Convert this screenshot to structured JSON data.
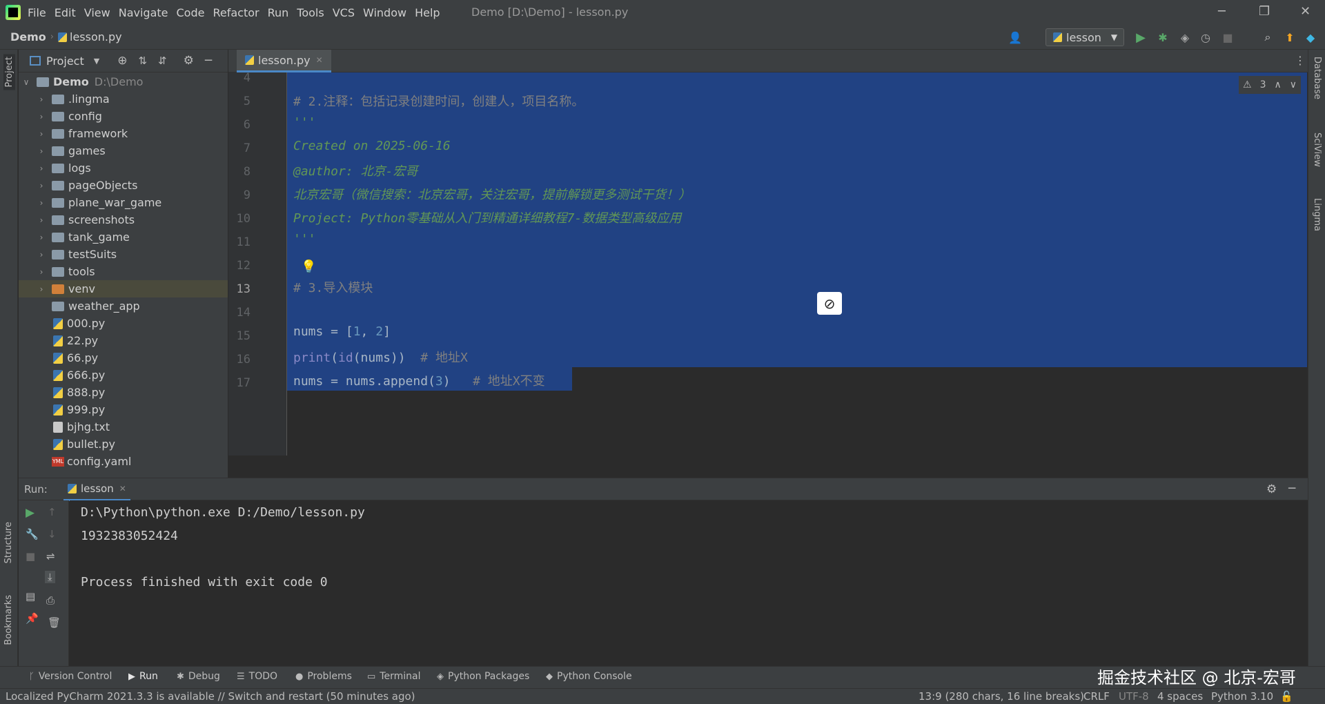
{
  "menu": {
    "items": [
      "File",
      "Edit",
      "View",
      "Navigate",
      "Code",
      "Refactor",
      "Run",
      "Tools",
      "VCS",
      "Window",
      "Help"
    ],
    "window_title": "Demo [D:\\Demo] - lesson.py"
  },
  "nav": {
    "project": "Demo",
    "file": "lesson.py",
    "run_config": "lesson"
  },
  "project_panel": {
    "title": "Project",
    "root_name": "Demo",
    "root_path": "D:\\Demo",
    "items": [
      ".lingma",
      "config",
      "framework",
      "games",
      "logs",
      "pageObjects",
      "plane_war_game",
      "screenshots",
      "tank_game",
      "testSuits",
      "tools",
      "venv",
      "weather_app",
      "000.py",
      "22.py",
      "66.py",
      "666.py",
      "888.py",
      "999.py",
      "bjhg.txt",
      "bullet.py",
      "config.yaml"
    ]
  },
  "editor": {
    "tab": "lesson.py",
    "warnings": "3",
    "line_numbers": [
      "4",
      "5",
      "6",
      "7",
      "8",
      "9",
      "10",
      "11",
      "12",
      "13",
      "14",
      "15",
      "16",
      "17"
    ],
    "lines": {
      "l5": "# 2.注释：包括记录创建时间，创建人，项目名称。",
      "l6": "'''",
      "l7": "Created on 2025-06-16",
      "l8": "@author: 北京-宏哥",
      "l9": "北京宏哥（微信搜索：北京宏哥，关注宏哥，提前解锁更多测试干货！）",
      "l10": "Project: Python零基础从入门到精通详细教程7-数据类型高级应用",
      "l11": "'''",
      "l13": "# 3.导入模块",
      "l15_a": "nums = [",
      "l15_b": "1",
      "l15_c": ", ",
      "l15_d": "2",
      "l15_e": "]",
      "l16_a": "print",
      "l16_b": "(",
      "l16_c": "id",
      "l16_d": "(nums))  ",
      "l16_e": "# 地址X",
      "l17_a": "nums = nums.append(",
      "l17_b": "3",
      "l17_c": ")   ",
      "l17_d": "# 地址X不变"
    }
  },
  "run_panel": {
    "label": "Run:",
    "tab": "lesson",
    "output": [
      "D:\\Python\\python.exe D:/Demo/lesson.py",
      "1932383052424",
      "",
      "Process finished with exit code 0"
    ]
  },
  "left_stripe": {
    "project": "Project",
    "structure": "Structure",
    "bookmarks": "Bookmarks"
  },
  "right_stripe": {
    "database": "Database",
    "sciview": "SciView",
    "lingma": "Lingma"
  },
  "tool_windows": [
    "Version Control",
    "Run",
    "Debug",
    "TODO",
    "Problems",
    "Terminal",
    "Python Packages",
    "Python Console"
  ],
  "status": {
    "message": "Localized PyCharm 2021.3.3 is available // Switch and restart (50 minutes ago)",
    "position": "13:9 (280 chars, 16 line breaks)",
    "line_sep": "CRLF",
    "encoding": "UTF-8",
    "indent": "4 spaces",
    "interpreter": "Python 3.10"
  },
  "watermark": "掘金技术社区 @ 北京-宏哥",
  "colors": {
    "selection": "#214283",
    "background": "#2b2b2b",
    "panel": "#3c3f41",
    "docstring": "#629755",
    "number": "#6897bb"
  }
}
